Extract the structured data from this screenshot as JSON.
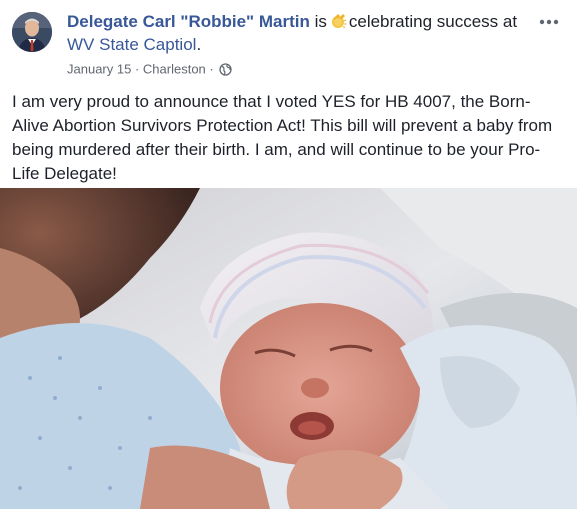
{
  "post": {
    "author": "Delegate Carl \"Robbie\" Martin",
    "is": "is",
    "activity_text": "celebrating success at",
    "place": "WV State Captiol",
    "date": "January 15",
    "location": "Charleston",
    "dot": "·",
    "body": "I am very proud to announce that I voted YES for HB 4007, the Born-Alive Abortion Survivors Protection Act! This bill will prevent a baby from being murdered after their birth. I am, and will continue to be your Pro-Life Delegate!"
  },
  "icons": {
    "activity": "clapping-hands-icon",
    "privacy": "globe-icon",
    "more": "more-options-icon"
  },
  "colors": {
    "link": "#385898",
    "text": "#1d2129",
    "meta": "#616770"
  }
}
